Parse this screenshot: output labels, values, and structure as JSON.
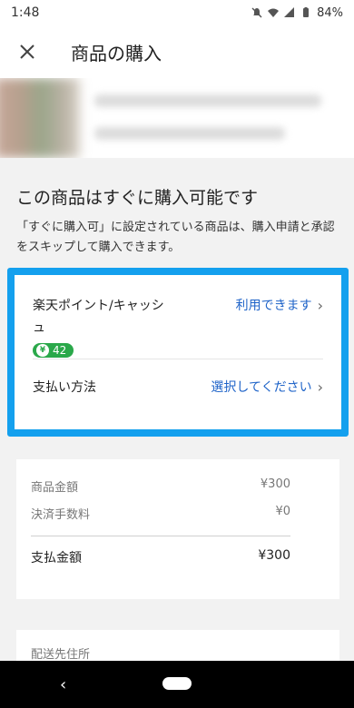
{
  "status": {
    "time": "1:48",
    "battery": "84%"
  },
  "app_bar": {
    "title": "商品の購入"
  },
  "ready": {
    "title": "この商品はすぐに購入可能です",
    "description": "「すぐに購入可」に設定されている商品は、購入申請と承認をスキップして購入できます。"
  },
  "payment": {
    "points_label": "楽天ポイント/キャッシュ",
    "points_badge": "42",
    "points_action": "利用できます",
    "method_label": "支払い方法",
    "method_action": "選択してください"
  },
  "price": {
    "item_label": "商品金額",
    "item_value": "¥300",
    "fee_label": "決済手数料",
    "fee_value": "¥0",
    "total_label": "支払金額",
    "total_value": "¥300"
  },
  "address": {
    "label": "配送先住所"
  },
  "nav": {
    "back": "‹"
  },
  "colors": {
    "highlight": "#14a0ee",
    "link": "#1e63c8",
    "badge": "#2aa84a"
  }
}
